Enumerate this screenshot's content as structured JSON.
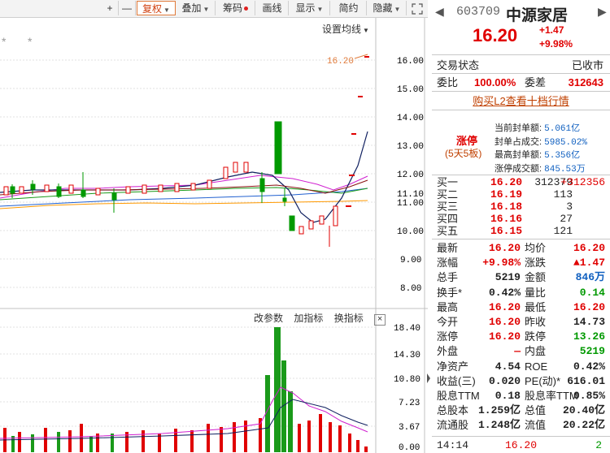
{
  "toolbar": {
    "plus": "+",
    "minus": "—",
    "fuquan": "复权",
    "diejia": "叠加",
    "chouma": "筹码",
    "huaxian": "画线",
    "xianshi": "显示",
    "jianyue": "简约",
    "yincang": "隐藏",
    "set_ma": "设置均线"
  },
  "price_axis": [
    "16.00",
    "15.00",
    "14.00",
    "13.00",
    "12.00",
    "11.10",
    "11.00",
    "10.00",
    "9.00",
    "8.00"
  ],
  "price_marker": "16.20",
  "volume_axis": [
    "18.40",
    "14.30",
    "10.80",
    "7.23",
    "3.67",
    "0.00"
  ],
  "sub_indicator": {
    "modify": "改参数",
    "add": "加指标",
    "switch": "换指标",
    "close": "×"
  },
  "stock": {
    "code": "603709",
    "name": "中源家居",
    "price": "16.20",
    "change": "+1.47",
    "change_pct": "+9.98%"
  },
  "status": {
    "label": "交易状态",
    "value": "已收市"
  },
  "weibi": {
    "label": "委比",
    "value": "100.00%",
    "diff_label": "委差",
    "diff_value": "312643"
  },
  "l2_link": "购买L2查看十档行情",
  "limit_up": {
    "tag": "涨停",
    "sub": "(5天5板)",
    "rows": [
      {
        "label": "当前封单额:",
        "value": "5.061亿"
      },
      {
        "label": "封单占成交:",
        "value": "5985.02%"
      },
      {
        "label": "最高封单额:",
        "value": "5.356亿"
      },
      {
        "label": "涨停成交额:",
        "value": "845.53万"
      }
    ]
  },
  "bids": [
    {
      "label": "买一",
      "price": "16.20",
      "vol": "312379",
      "extra": "+312356"
    },
    {
      "label": "买二",
      "price": "16.19",
      "vol": "113",
      "extra": ""
    },
    {
      "label": "买三",
      "price": "16.18",
      "vol": "3",
      "extra": ""
    },
    {
      "label": "买四",
      "price": "16.16",
      "vol": "27",
      "extra": ""
    },
    {
      "label": "买五",
      "price": "16.15",
      "vol": "121",
      "extra": ""
    }
  ],
  "stats": [
    {
      "l1": "最新",
      "v1": "16.20",
      "c1": "red",
      "l2": "均价",
      "v2": "16.20",
      "c2": "red"
    },
    {
      "l1": "涨幅",
      "v1": "+9.98%",
      "c1": "red",
      "l2": "涨跌",
      "v2": "▲1.47",
      "c2": "red"
    },
    {
      "l1": "总手",
      "v1": "5219",
      "c1": "dark",
      "l2": "金额",
      "v2": "846万",
      "c2": "blue"
    },
    {
      "l1": "换手*",
      "v1": "0.42%",
      "c1": "dark",
      "l2": "量比",
      "v2": "0.14",
      "c2": "green"
    },
    {
      "l1": "最高",
      "v1": "16.20",
      "c1": "red",
      "l2": "最低",
      "v2": "16.20",
      "c2": "red"
    },
    {
      "l1": "今开",
      "v1": "16.20",
      "c1": "red",
      "l2": "昨收",
      "v2": "14.73",
      "c2": "dark"
    },
    {
      "l1": "涨停",
      "v1": "16.20",
      "c1": "red",
      "l2": "跌停",
      "v2": "13.26",
      "c2": "green"
    },
    {
      "l1": "外盘",
      "v1": "—",
      "c1": "red",
      "l2": "内盘",
      "v2": "5219",
      "c2": "green"
    },
    {
      "l1": "净资产",
      "v1": "4.54",
      "c1": "dark",
      "l2": "ROE",
      "v2": "0.42%",
      "c2": "dark"
    },
    {
      "l1": "收益(三)",
      "v1": "0.020",
      "c1": "dark",
      "l2": "PE(动)*",
      "v2": "616.01",
      "c2": "dark"
    },
    {
      "l1": "股息TTM",
      "v1": "0.18",
      "c1": "dark",
      "l2": "股息率TTM",
      "v2": "0.85%",
      "c2": "dark"
    },
    {
      "l1": "总股本",
      "v1": "1.259亿",
      "c1": "dark",
      "l2": "总值",
      "v2": "20.40亿",
      "c2": "dark"
    },
    {
      "l1": "流通股",
      "v1": "1.248亿",
      "c1": "dark",
      "l2": "流值",
      "v2": "20.22亿",
      "c2": "dark"
    }
  ],
  "tick": {
    "time": "14:14",
    "price": "16.20",
    "vol": "2"
  },
  "colors": {
    "up": "#e00000",
    "down": "#009900",
    "accent": "#e07a3a"
  }
}
